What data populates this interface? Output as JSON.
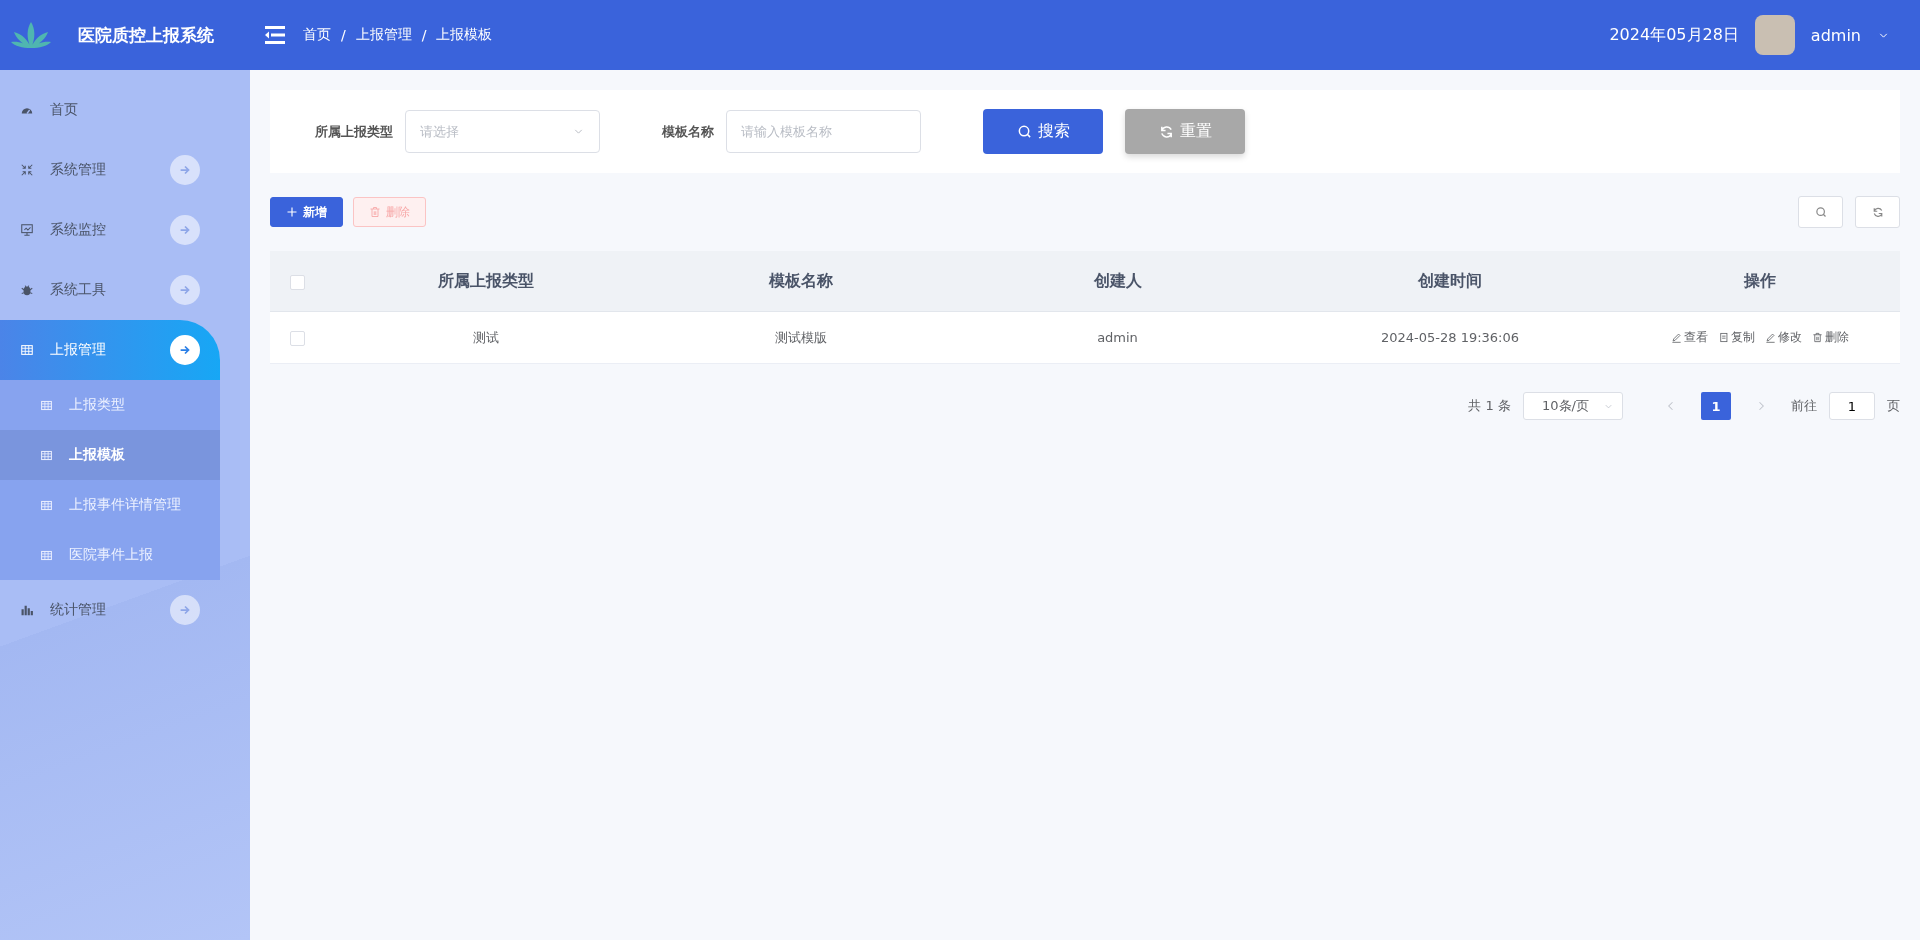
{
  "header": {
    "title": "医院质控上报系统",
    "breadcrumb": [
      "首页",
      "上报管理",
      "上报模板"
    ],
    "separator": "/",
    "date": "2024年05月28日",
    "user": "admin"
  },
  "sidebar": {
    "items": [
      {
        "label": "首页",
        "kind": "link",
        "selected": false
      },
      {
        "label": "系统管理",
        "kind": "group",
        "selected": false
      },
      {
        "label": "系统监控",
        "kind": "group",
        "selected": false
      },
      {
        "label": "系统工具",
        "kind": "group",
        "selected": false
      },
      {
        "label": "上报管理",
        "kind": "group",
        "selected": true,
        "children": [
          {
            "label": "上报类型",
            "selected": false
          },
          {
            "label": "上报模板",
            "selected": true
          },
          {
            "label": "上报事件详情管理",
            "selected": false
          },
          {
            "label": "医院事件上报",
            "selected": false
          }
        ]
      },
      {
        "label": "统计管理",
        "kind": "group",
        "selected": false
      }
    ]
  },
  "filters": [
    {
      "label": "所属上报类型",
      "kind": "select",
      "placeholder": "请选择"
    },
    {
      "label": "模板名称",
      "kind": "input",
      "placeholder": "请输入模板名称"
    }
  ],
  "filter_buttons": [
    {
      "label": "搜索",
      "kind": "search"
    },
    {
      "label": "重置",
      "kind": "reset"
    }
  ],
  "toolbar": [
    {
      "label": "新增",
      "kind": "add",
      "disabled": false
    },
    {
      "label": "删除",
      "kind": "delete",
      "disabled": true
    }
  ],
  "table": {
    "all_checked": false,
    "columns": [
      "所属上报类型",
      "模板名称",
      "创建人",
      "创建时间",
      "操作"
    ],
    "rows": [
      {
        "checked": false,
        "cells": [
          "测试",
          "测试模版",
          "admin",
          "2024-05-28 19:36:06"
        ],
        "actions": [
          "查看",
          "复制",
          "修改",
          "删除"
        ]
      }
    ]
  },
  "pagination": {
    "total": "共 1 条",
    "page_size": "10条/页",
    "pages": [
      {
        "label": "1",
        "selected": true
      }
    ],
    "goto_label": "前往",
    "goto_value": "1",
    "goto_suffix": "页"
  }
}
